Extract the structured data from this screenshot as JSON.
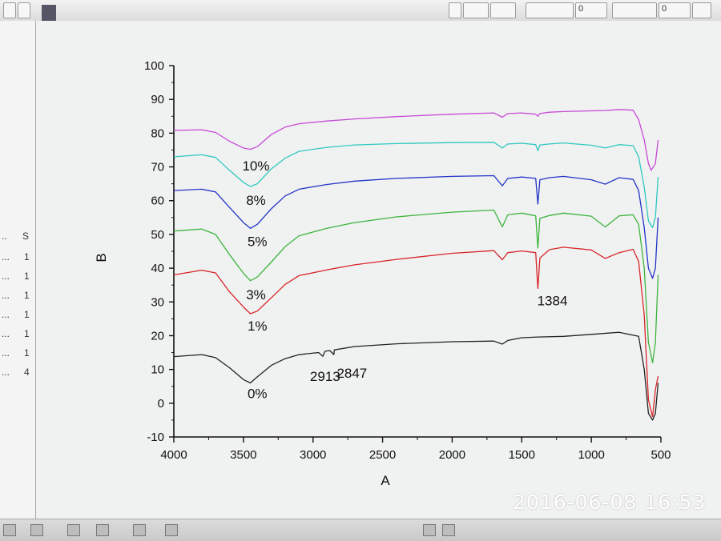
{
  "left_panel": {
    "header": [
      "..",
      "S"
    ],
    "rows": [
      [
        "...",
        "1"
      ],
      [
        "...",
        "1"
      ],
      [
        "...",
        "1"
      ],
      [
        "...",
        "1"
      ],
      [
        "...",
        "1"
      ],
      [
        "...",
        "1"
      ],
      [
        "...",
        "4"
      ]
    ]
  },
  "toolbar": {
    "values": [
      "0",
      "0"
    ]
  },
  "timestamp": "2016-06-08  16:53",
  "colors": {
    "0%": "#222222",
    "1%": "#d8262a",
    "3%": "#3db53d",
    "5%": "#2335c8",
    "8%": "#2fc9c0",
    "10%": "#c74ad6"
  },
  "chart_data": {
    "type": "line",
    "xlabel": "A",
    "ylabel": "B",
    "xlim": [
      4000,
      500
    ],
    "ylim": [
      -10,
      100
    ],
    "x_ticks": [
      "4000",
      "3500",
      "3000",
      "2500",
      "2000",
      "1500",
      "1000",
      "500"
    ],
    "y_ticks": [
      "-10",
      "0",
      "10",
      "20",
      "30",
      "40",
      "50",
      "60",
      "70",
      "80",
      "90",
      "100"
    ],
    "series": [
      {
        "name": "0%",
        "values": [
          [
            4000,
            13.8
          ],
          [
            3800,
            14.4
          ],
          [
            3700,
            13.5
          ],
          [
            3600,
            10.5
          ],
          [
            3500,
            7
          ],
          [
            3450,
            6
          ],
          [
            3400,
            7.8
          ],
          [
            3300,
            11.2
          ],
          [
            3200,
            13.2
          ],
          [
            3100,
            14.4
          ],
          [
            2960,
            15
          ],
          [
            2930,
            13.9
          ],
          [
            2913,
            15.4
          ],
          [
            2880,
            15.6
          ],
          [
            2850,
            14.4
          ],
          [
            2847,
            15.8
          ],
          [
            2700,
            16.8
          ],
          [
            2400,
            17.6
          ],
          [
            2000,
            18.2
          ],
          [
            1700,
            18.4
          ],
          [
            1640,
            17.5
          ],
          [
            1600,
            18.6
          ],
          [
            1500,
            19.4
          ],
          [
            1384,
            19.6
          ],
          [
            1200,
            19.8
          ],
          [
            1000,
            20.4
          ],
          [
            800,
            21
          ],
          [
            660,
            19.8
          ],
          [
            620,
            10
          ],
          [
            590,
            -3
          ],
          [
            560,
            -5
          ],
          [
            540,
            -3
          ],
          [
            520,
            6
          ]
        ]
      },
      {
        "name": "1%",
        "values": [
          [
            4000,
            38
          ],
          [
            3800,
            39.4
          ],
          [
            3700,
            38.6
          ],
          [
            3600,
            33
          ],
          [
            3500,
            28.5
          ],
          [
            3450,
            26.5
          ],
          [
            3400,
            27.3
          ],
          [
            3300,
            31.2
          ],
          [
            3200,
            35.2
          ],
          [
            3100,
            37.8
          ],
          [
            2900,
            39.5
          ],
          [
            2700,
            41
          ],
          [
            2400,
            42.6
          ],
          [
            2000,
            44.4
          ],
          [
            1700,
            45.2
          ],
          [
            1640,
            42.5
          ],
          [
            1600,
            44.6
          ],
          [
            1500,
            45.1
          ],
          [
            1400,
            44.6
          ],
          [
            1384,
            34
          ],
          [
            1370,
            43
          ],
          [
            1300,
            45.5
          ],
          [
            1200,
            46.2
          ],
          [
            1000,
            45.4
          ],
          [
            900,
            42.9
          ],
          [
            800,
            44.6
          ],
          [
            700,
            45.6
          ],
          [
            660,
            42
          ],
          [
            620,
            26
          ],
          [
            590,
            1
          ],
          [
            560,
            -4
          ],
          [
            540,
            4
          ],
          [
            520,
            8
          ]
        ]
      },
      {
        "name": "3%",
        "values": [
          [
            4000,
            51
          ],
          [
            3800,
            51.6
          ],
          [
            3700,
            50
          ],
          [
            3600,
            44
          ],
          [
            3500,
            38.5
          ],
          [
            3450,
            36.3
          ],
          [
            3400,
            37.4
          ],
          [
            3300,
            41.8
          ],
          [
            3200,
            46.4
          ],
          [
            3100,
            49.6
          ],
          [
            2900,
            51.8
          ],
          [
            2700,
            53.5
          ],
          [
            2400,
            55.2
          ],
          [
            2000,
            56.6
          ],
          [
            1700,
            57.2
          ],
          [
            1640,
            52.2
          ],
          [
            1600,
            55.8
          ],
          [
            1500,
            56.3
          ],
          [
            1400,
            55.5
          ],
          [
            1384,
            46
          ],
          [
            1370,
            54.8
          ],
          [
            1300,
            55.6
          ],
          [
            1200,
            56.3
          ],
          [
            1000,
            55.4
          ],
          [
            900,
            52.2
          ],
          [
            800,
            55.5
          ],
          [
            700,
            55.8
          ],
          [
            660,
            53
          ],
          [
            620,
            40
          ],
          [
            590,
            18
          ],
          [
            560,
            12
          ],
          [
            540,
            18
          ],
          [
            520,
            38
          ]
        ]
      },
      {
        "name": "5%",
        "values": [
          [
            4000,
            63
          ],
          [
            3800,
            63.4
          ],
          [
            3700,
            62.6
          ],
          [
            3600,
            58
          ],
          [
            3500,
            53.5
          ],
          [
            3450,
            51.8
          ],
          [
            3400,
            53
          ],
          [
            3300,
            57.6
          ],
          [
            3200,
            61.4
          ],
          [
            3100,
            63.4
          ],
          [
            2900,
            64.8
          ],
          [
            2700,
            65.8
          ],
          [
            2400,
            66.6
          ],
          [
            2000,
            67.2
          ],
          [
            1700,
            67.4
          ],
          [
            1640,
            64.4
          ],
          [
            1600,
            66.6
          ],
          [
            1500,
            67
          ],
          [
            1400,
            66.6
          ],
          [
            1384,
            59
          ],
          [
            1370,
            66.2
          ],
          [
            1300,
            66.8
          ],
          [
            1200,
            67.2
          ],
          [
            1000,
            66.2
          ],
          [
            900,
            64.9
          ],
          [
            800,
            66.8
          ],
          [
            700,
            66.3
          ],
          [
            660,
            63
          ],
          [
            620,
            52
          ],
          [
            590,
            40
          ],
          [
            560,
            37
          ],
          [
            540,
            40
          ],
          [
            520,
            55
          ]
        ]
      },
      {
        "name": "8%",
        "values": [
          [
            4000,
            73
          ],
          [
            3800,
            73.6
          ],
          [
            3700,
            72.8
          ],
          [
            3600,
            69
          ],
          [
            3500,
            65.4
          ],
          [
            3450,
            64.2
          ],
          [
            3400,
            65
          ],
          [
            3300,
            69.4
          ],
          [
            3200,
            72.6
          ],
          [
            3100,
            74.6
          ],
          [
            2900,
            75.8
          ],
          [
            2700,
            76.5
          ],
          [
            2400,
            76.9
          ],
          [
            2000,
            77.2
          ],
          [
            1700,
            77.3
          ],
          [
            1640,
            75.6
          ],
          [
            1600,
            76.8
          ],
          [
            1500,
            77
          ],
          [
            1400,
            76.6
          ],
          [
            1384,
            74.8
          ],
          [
            1370,
            76.5
          ],
          [
            1300,
            76.8
          ],
          [
            1200,
            77.1
          ],
          [
            1000,
            76.4
          ],
          [
            900,
            75.6
          ],
          [
            800,
            76.6
          ],
          [
            700,
            76.3
          ],
          [
            660,
            73
          ],
          [
            620,
            64
          ],
          [
            590,
            54
          ],
          [
            560,
            52
          ],
          [
            540,
            55
          ],
          [
            520,
            67
          ]
        ]
      },
      {
        "name": "10%",
        "values": [
          [
            4000,
            80.8
          ],
          [
            3800,
            81
          ],
          [
            3700,
            80.2
          ],
          [
            3600,
            77.6
          ],
          [
            3500,
            75.6
          ],
          [
            3450,
            75.2
          ],
          [
            3400,
            76
          ],
          [
            3300,
            79.6
          ],
          [
            3200,
            81.8
          ],
          [
            3100,
            82.8
          ],
          [
            2900,
            83.6
          ],
          [
            2700,
            84.2
          ],
          [
            2400,
            84.9
          ],
          [
            2000,
            85.6
          ],
          [
            1700,
            86
          ],
          [
            1640,
            84.7
          ],
          [
            1600,
            85.8
          ],
          [
            1500,
            86
          ],
          [
            1400,
            85.6
          ],
          [
            1384,
            85
          ],
          [
            1370,
            85.8
          ],
          [
            1300,
            86.2
          ],
          [
            1200,
            86.4
          ],
          [
            1000,
            86.6
          ],
          [
            900,
            86.7
          ],
          [
            800,
            87
          ],
          [
            700,
            86.8
          ],
          [
            660,
            84
          ],
          [
            620,
            78
          ],
          [
            590,
            71
          ],
          [
            570,
            69
          ],
          [
            540,
            71
          ],
          [
            520,
            78
          ]
        ]
      }
    ],
    "annotations": [
      {
        "text": "0%",
        "x": 3400,
        "y": 1.5
      },
      {
        "text": "2913",
        "x": 2913,
        "y": 6.6
      },
      {
        "text": "2847",
        "x": 2720,
        "y": 7.6
      },
      {
        "text": "1%",
        "x": 3400,
        "y": 21.5
      },
      {
        "text": "3%",
        "x": 3410,
        "y": 30.8
      },
      {
        "text": "1384",
        "x": 1280,
        "y": 29
      },
      {
        "text": "5%",
        "x": 3400,
        "y": 46.5
      },
      {
        "text": "8%",
        "x": 3410,
        "y": 58.8
      },
      {
        "text": "10%",
        "x": 3410,
        "y": 68.9
      }
    ]
  }
}
